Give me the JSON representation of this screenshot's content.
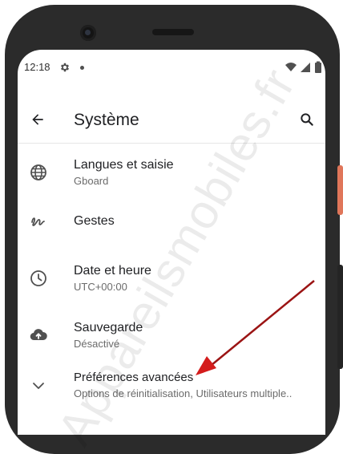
{
  "status_bar": {
    "time": "12:18"
  },
  "app_bar": {
    "title": "Système"
  },
  "items": [
    {
      "title": "Langues et saisie",
      "summary": "Gboard",
      "icon": "globe-icon"
    },
    {
      "title": "Gestes",
      "summary": "",
      "icon": "gesture-icon"
    },
    {
      "title": "Date et heure",
      "summary": "UTC+00:00",
      "icon": "clock-icon"
    },
    {
      "title": "Sauvegarde",
      "summary": "Désactivé",
      "icon": "cloud-upload-icon"
    },
    {
      "title": "Préférences avancées",
      "summary": "Options de réinitialisation, Utilisateurs multiple..",
      "icon": "chevron-down-icon"
    }
  ],
  "watermark": "Appareilsmobiles.fr",
  "colors": {
    "annotation_arrow": "#cc1a1a",
    "frame": "#2b2b2b",
    "power_button": "#e0765a"
  }
}
